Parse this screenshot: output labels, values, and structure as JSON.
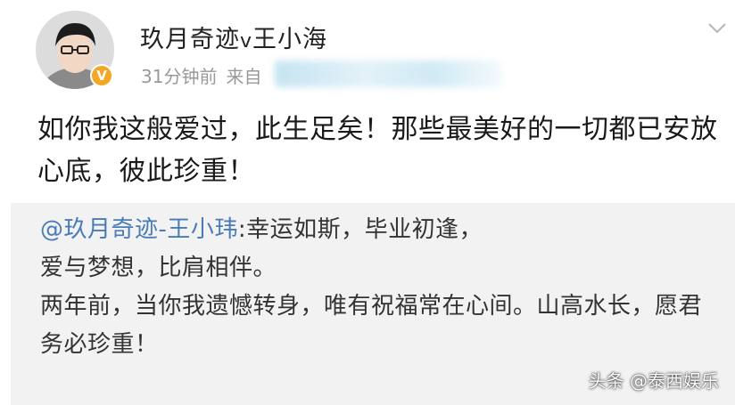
{
  "post": {
    "username": "玖月奇迹",
    "username_suffix": "v",
    "username_tail": "王小海",
    "avatar_icon": "user-avatar-icon",
    "verified_badge": "V",
    "time_ago": "31分钟前",
    "source_prefix": "来自",
    "text": "如你我这般爱过，此生足矣！那些最美好的一切都已安放心底，彼此珍重！"
  },
  "repost": {
    "mention": "@玖月奇迹-王小玮",
    "line1": ":幸运如斯，毕业初逢，",
    "line2": "爱与梦想，比肩相伴。",
    "line3": "两年前，当你我遗憾转身，唯有祝福常在心间。山高水长，愿君务必珍重！"
  },
  "watermark": "头条 @泰西娱乐",
  "colors": {
    "mention": "#4a7bb7",
    "badge": "#f5a623",
    "repost_bg": "#f2f2f2",
    "meta": "#999999"
  }
}
